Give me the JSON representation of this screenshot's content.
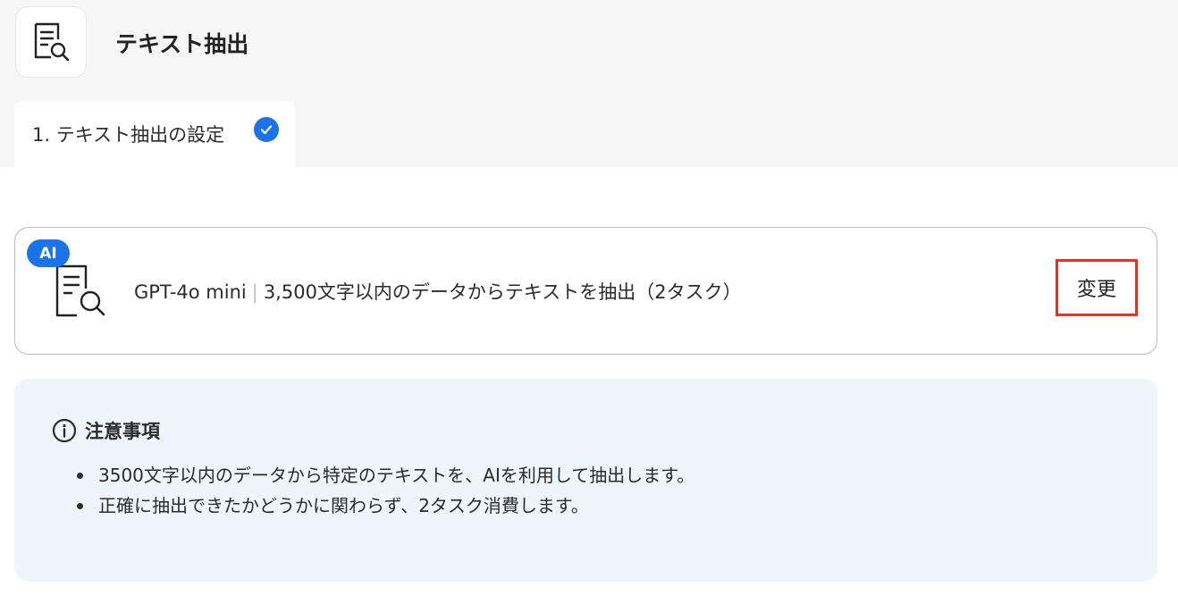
{
  "header": {
    "title": "テキスト抽出",
    "icon": "document-search-icon"
  },
  "steps": [
    {
      "label": "1. テキスト抽出の設定",
      "status": "completed",
      "icon": "check-circle-icon"
    }
  ],
  "action_card": {
    "badge": "AI",
    "icon": "document-search-icon",
    "model": "GPT-4o mini",
    "separator": "|",
    "description": "3,500文字以内のデータからテキストを抽出（2タスク）",
    "change_label": "変更"
  },
  "notice": {
    "icon": "info-circle-icon",
    "title": "注意事項",
    "items": [
      "3500文字以内のデータから特定のテキストを、AIを利用して抽出します。",
      "正確に抽出できたかどうかに関わらず、2タスク消費します。"
    ]
  },
  "colors": {
    "accent": "#1a73e8",
    "highlight": "#e8341c",
    "notice_bg": "#eef5fd",
    "top_bg": "#f6f6f6"
  }
}
